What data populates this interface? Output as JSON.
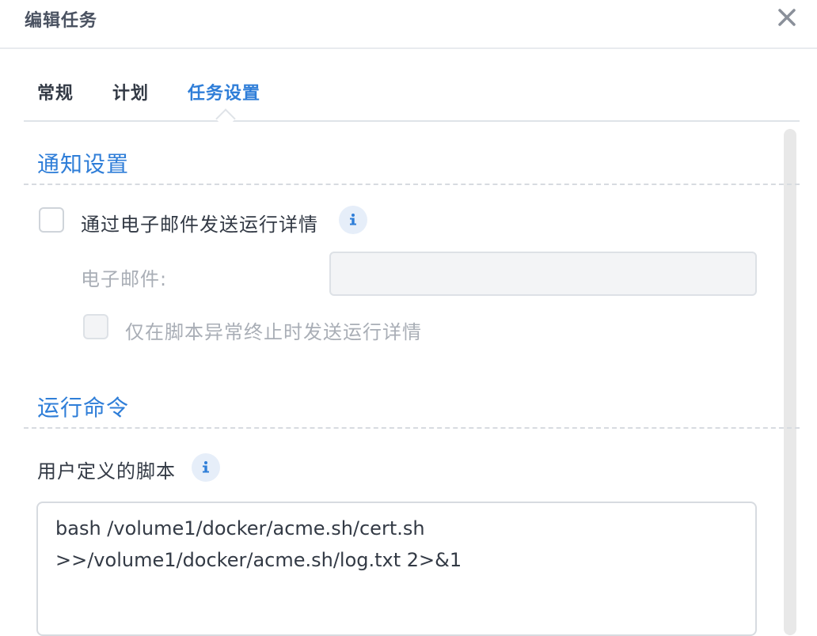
{
  "dialog": {
    "title": "编辑任务",
    "close_icon": "close-icon"
  },
  "tabs": [
    {
      "label": "常规",
      "active": false
    },
    {
      "label": "计划",
      "active": false
    },
    {
      "label": "任务设置",
      "active": true
    }
  ],
  "notification": {
    "section_title": "通知设置",
    "send_email_label": "通过电子邮件发送运行详情",
    "send_email_checked": false,
    "email_label": "电子邮件:",
    "email_value": "",
    "only_on_error_label": "仅在脚本异常终止时发送运行详情",
    "only_on_error_checked": false
  },
  "run_command": {
    "section_title": "运行命令",
    "script_label": "用户定义的脚本",
    "script_lines": [
      "bash /volume1/docker/acme.sh/cert.sh",
      ">>/volume1/docker/acme.sh/log.txt 2>&1"
    ]
  },
  "colors": {
    "accent": "#2f7ed8",
    "info_bg": "#e6eef9"
  }
}
